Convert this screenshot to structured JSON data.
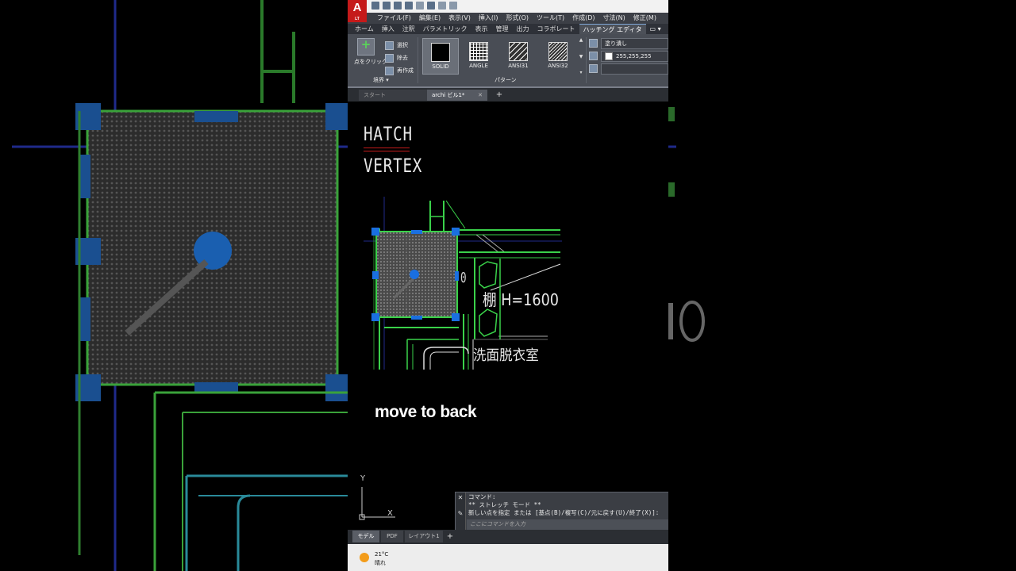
{
  "app": {
    "logo": "A",
    "edition": "LT"
  },
  "menu": [
    "ファイル(F)",
    "編集(E)",
    "表示(V)",
    "挿入(I)",
    "形式(O)",
    "ツール(T)",
    "作成(D)",
    "寸法(N)",
    "修正(M)"
  ],
  "ribbon_tabs": [
    "ホーム",
    "挿入",
    "注釈",
    "パラメトリック",
    "表示",
    "管理",
    "出力",
    "コラボレート",
    "ハッチング エディタ"
  ],
  "ribbon_tab_overflow": "▭ ▾",
  "boundary_panel": {
    "pick_label": "点をクリック",
    "items": [
      "選択",
      "除去",
      "再作成"
    ],
    "title": "境界 ▾"
  },
  "pattern_panel": {
    "title": "パターン",
    "patterns": [
      "SOLID",
      "ANGLE",
      "ANSI31",
      "ANSI32"
    ]
  },
  "properties_panel": {
    "type": "塗り潰し",
    "color": "255,255,255"
  },
  "doc_tabs": {
    "start": "スタート",
    "current": "archi ビル1*",
    "add": "+"
  },
  "drawing": {
    "title1": "HATCH",
    "title2": "VERTEX",
    "label_height": "棚 H=1600",
    "label_room": "洗面脱衣室",
    "dim_fragment": "0"
  },
  "caption": "move to back",
  "ucs": {
    "y": "Y",
    "x": "X"
  },
  "command": {
    "history": [
      "コマンド:",
      "** ストレッチ モード **",
      "新しい点を指定 または [基点(B)/複写(C)/元に戻す(U)/終了(X)]:"
    ],
    "placeholder": "ここにコマンドを入力",
    "close": "✕",
    "wrench": "✎"
  },
  "layout_tabs": [
    "モデル",
    "PDF",
    "レイアウト1",
    "+"
  ],
  "taskbar": {
    "temperature": "21°C",
    "condition": "晴れ"
  },
  "colors": {
    "hatch_border": "#3ad24a",
    "grip": "#1a6fe0",
    "ribbon_bg": "#494d55",
    "logo_red": "#c51a1a"
  }
}
